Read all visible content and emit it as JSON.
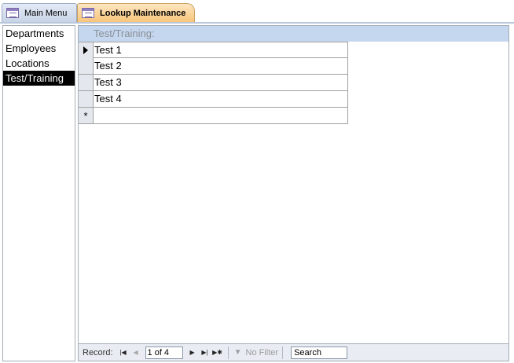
{
  "tabs": [
    {
      "label": "Main Menu",
      "icon": "form-icon",
      "active": false
    },
    {
      "label": "Lookup Maintenance",
      "icon": "form-icon",
      "active": true
    }
  ],
  "left_list": {
    "items": [
      "Departments",
      "Employees",
      "Locations",
      "Test/Training"
    ],
    "selected": "Test/Training"
  },
  "subform": {
    "header": "Test/Training:",
    "rows": [
      "Test 1",
      "Test 2",
      "Test 3",
      "Test 4"
    ],
    "new_record_symbol": "*"
  },
  "navigation": {
    "record_label": "Record:",
    "current": "1 of 4",
    "filter_label": "No Filter",
    "search_value": "Search",
    "first_icon": "first-record-icon",
    "prev_icon": "prev-record-icon",
    "next_icon": "next-record-icon",
    "last_icon": "last-record-icon",
    "new_icon": "new-record-icon",
    "filter_icon": "filter-icon"
  },
  "colors": {
    "active_tab": "#f7c57a",
    "header_band": "#c5d7ee",
    "selected_item_bg": "#000000"
  }
}
